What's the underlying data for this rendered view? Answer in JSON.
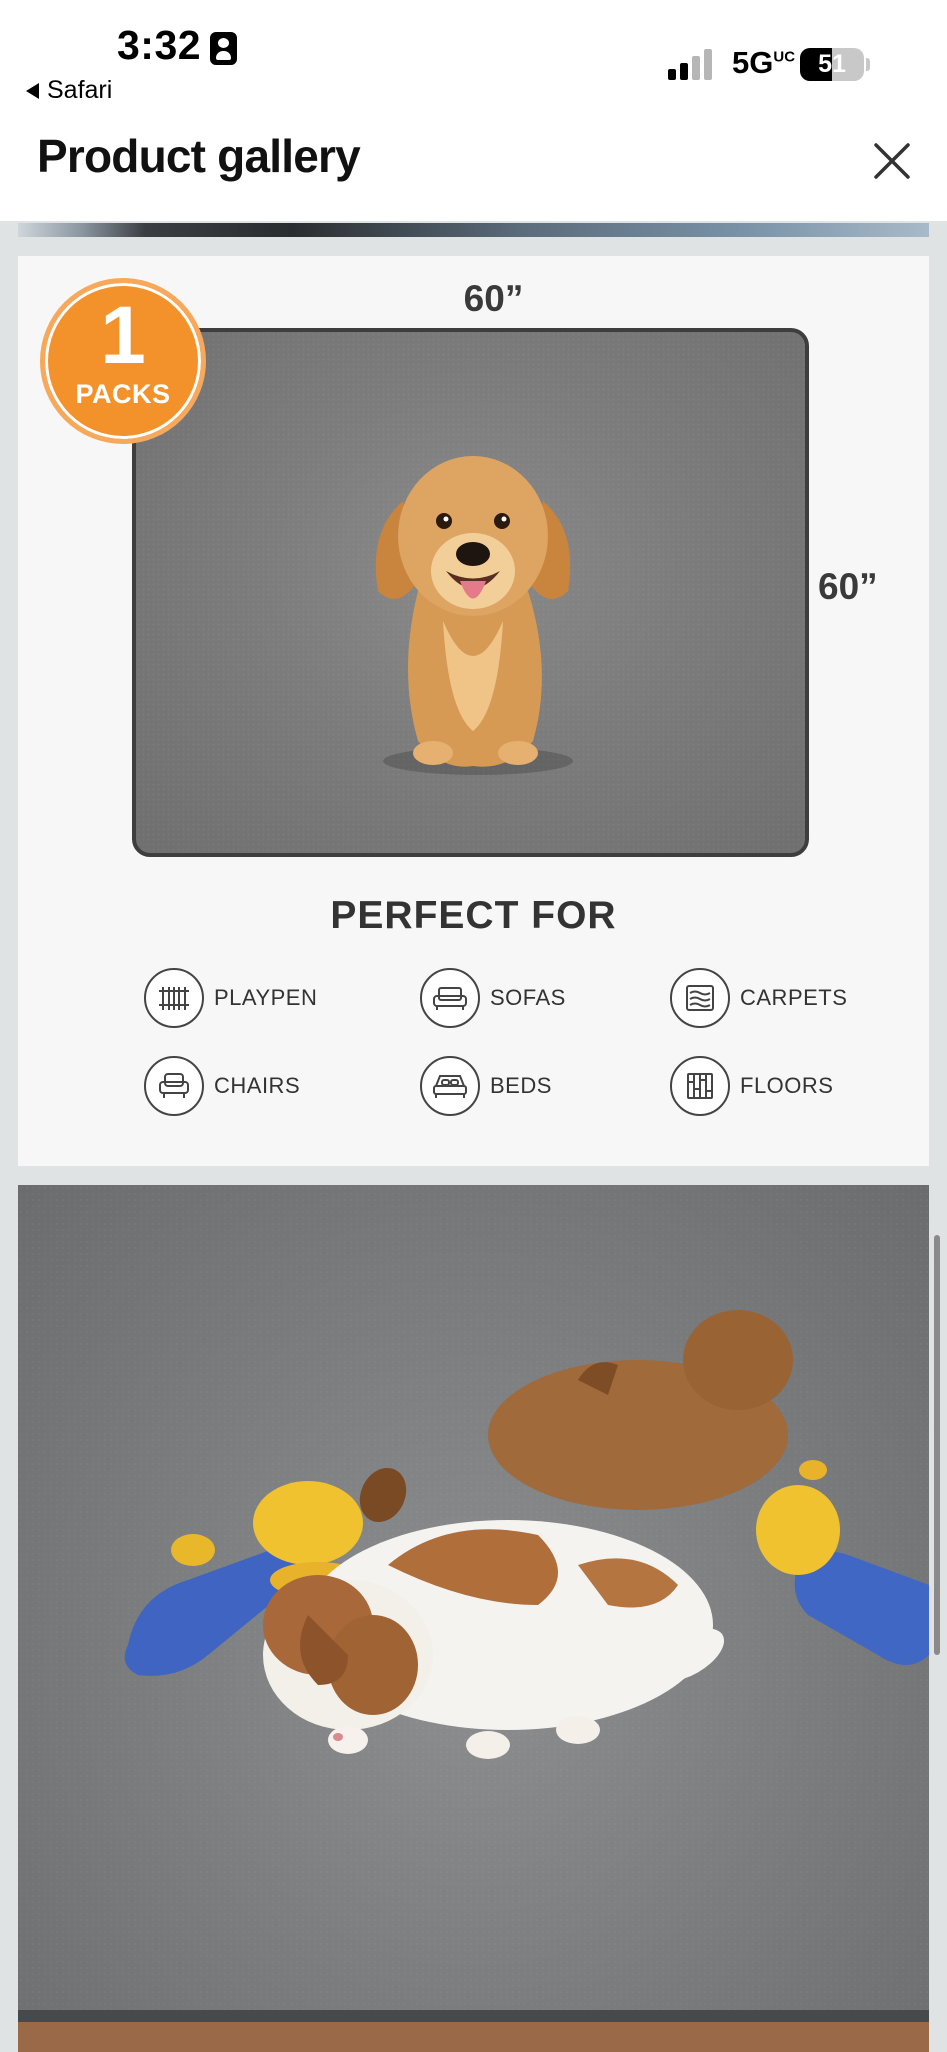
{
  "status_bar": {
    "time": "3:32",
    "back_app": "Safari",
    "network": "5G",
    "network_sup": "UC",
    "battery_percent": "51"
  },
  "header": {
    "title": "Product gallery"
  },
  "card1": {
    "badge_number": "1",
    "badge_label": "PACKS",
    "width_label": "60”",
    "height_label": "60”",
    "perfect_for": "PERFECT FOR",
    "uses": [
      {
        "label": "PLAYPEN",
        "icon": "playpen-icon"
      },
      {
        "label": "SOFAS",
        "icon": "sofa-icon"
      },
      {
        "label": "CARPETS",
        "icon": "carpet-icon"
      },
      {
        "label": "CHAIRS",
        "icon": "chair-icon"
      },
      {
        "label": "BEDS",
        "icon": "bed-icon"
      },
      {
        "label": "FLOORS",
        "icon": "floor-icon"
      }
    ]
  },
  "colors": {
    "badge": "#f3922b",
    "mat": "#7c7c7c",
    "background": "#dfe3e4"
  }
}
